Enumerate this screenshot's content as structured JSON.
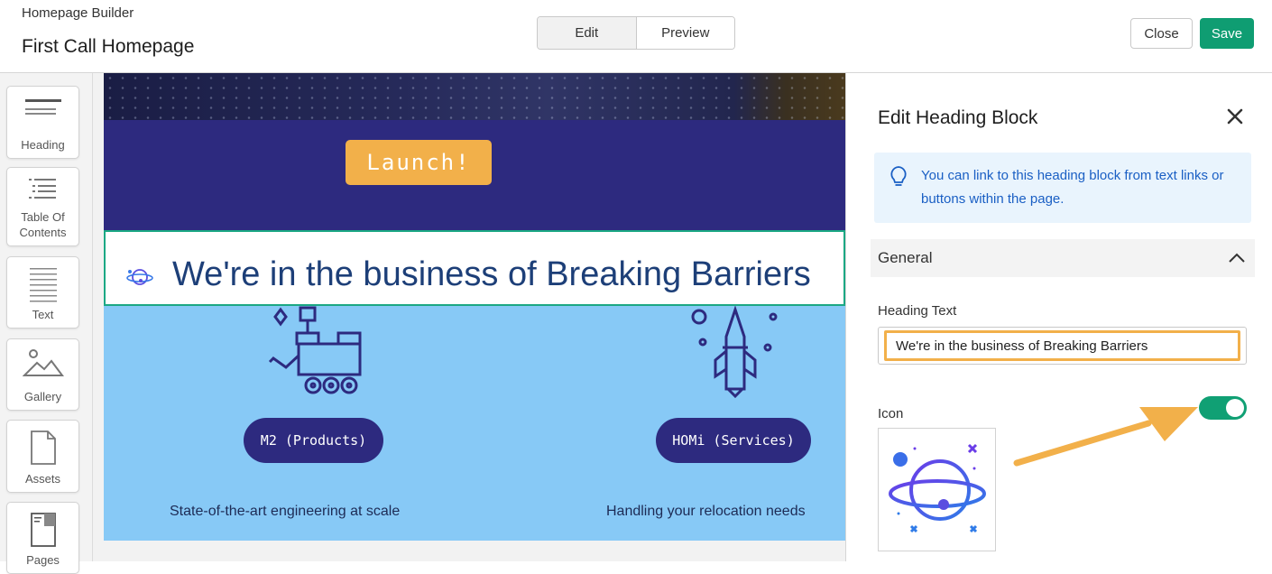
{
  "header": {
    "app_name": "Homepage Builder",
    "page_title": "First Call Homepage",
    "modes": [
      "Edit",
      "Preview"
    ],
    "active_mode": "Edit",
    "close_label": "Close",
    "save_label": "Save"
  },
  "toolbox": {
    "items": [
      {
        "label": "Heading",
        "icon": "heading-icon"
      },
      {
        "label": "Table Of Contents",
        "icon": "table-of-contents-icon"
      },
      {
        "label": "Text",
        "icon": "text-icon"
      },
      {
        "label": "Gallery",
        "icon": "gallery-icon"
      },
      {
        "label": "Assets",
        "icon": "file-icon"
      },
      {
        "label": "Pages",
        "icon": "pages-icon"
      }
    ]
  },
  "canvas": {
    "launch_label": "Launch!",
    "heading_text": "We're in the business of Breaking Barriers",
    "services": [
      {
        "button": "M2 (Products)",
        "caption": "State-of-the-art engineering at scale",
        "icon": "rover-icon"
      },
      {
        "button": "HOMi (Services)",
        "caption": "Handling your relocation needs",
        "icon": "rocket-icon"
      }
    ]
  },
  "panel": {
    "title": "Edit Heading Block",
    "info": "You can link to this heading block from text links or buttons within the page.",
    "section_title": "General",
    "heading_text_label": "Heading Text",
    "heading_text_value": "We're in the business of Breaking Barriers",
    "icon_label": "Icon",
    "icon_enabled": true,
    "icon_name": "planet-icon"
  },
  "colors": {
    "accent_green": "#0f9d72",
    "launch_orange": "#f2b04a",
    "navy": "#2d2a7f",
    "sky_blue": "#87c9f6",
    "heading_blue": "#1d3f78",
    "info_blue": "#1a5fc4"
  }
}
